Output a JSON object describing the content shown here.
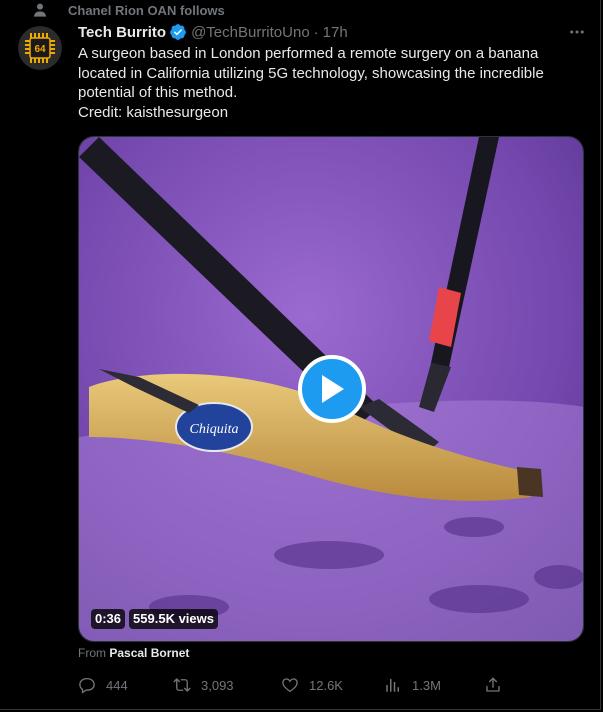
{
  "social_context": {
    "text": "Chanel Rion OAN follows",
    "icon": "person-icon"
  },
  "author": {
    "display_name": "Tech Burrito",
    "handle": "@TechBurritoUno",
    "separator": "·",
    "time": "17h",
    "verified": true,
    "avatar_label": "64",
    "avatar_colors": {
      "bg": "#2b2b2b",
      "chip": "#f2a900"
    }
  },
  "tweet": {
    "text": "A surgeon based in London performed a remote surgery on a banana located in California utilizing 5G technology, showcasing the incredible potential of this method.\nCredit: kaisthesurgeon"
  },
  "video": {
    "duration": "0:36",
    "views": "559.5K views",
    "label_text": "Chiquita",
    "colors": {
      "background": "#7b4fb5",
      "play": "#1d9bf0"
    }
  },
  "source": {
    "prefix": "From",
    "name": "Pascal Bornet"
  },
  "actions": {
    "replies": "444",
    "retweets": "3,093",
    "likes": "12.6K",
    "views": "1.3M"
  },
  "colors": {
    "accent": "#1d9bf0",
    "muted": "#71767b",
    "text": "#e7e9ea",
    "background": "#000000"
  }
}
